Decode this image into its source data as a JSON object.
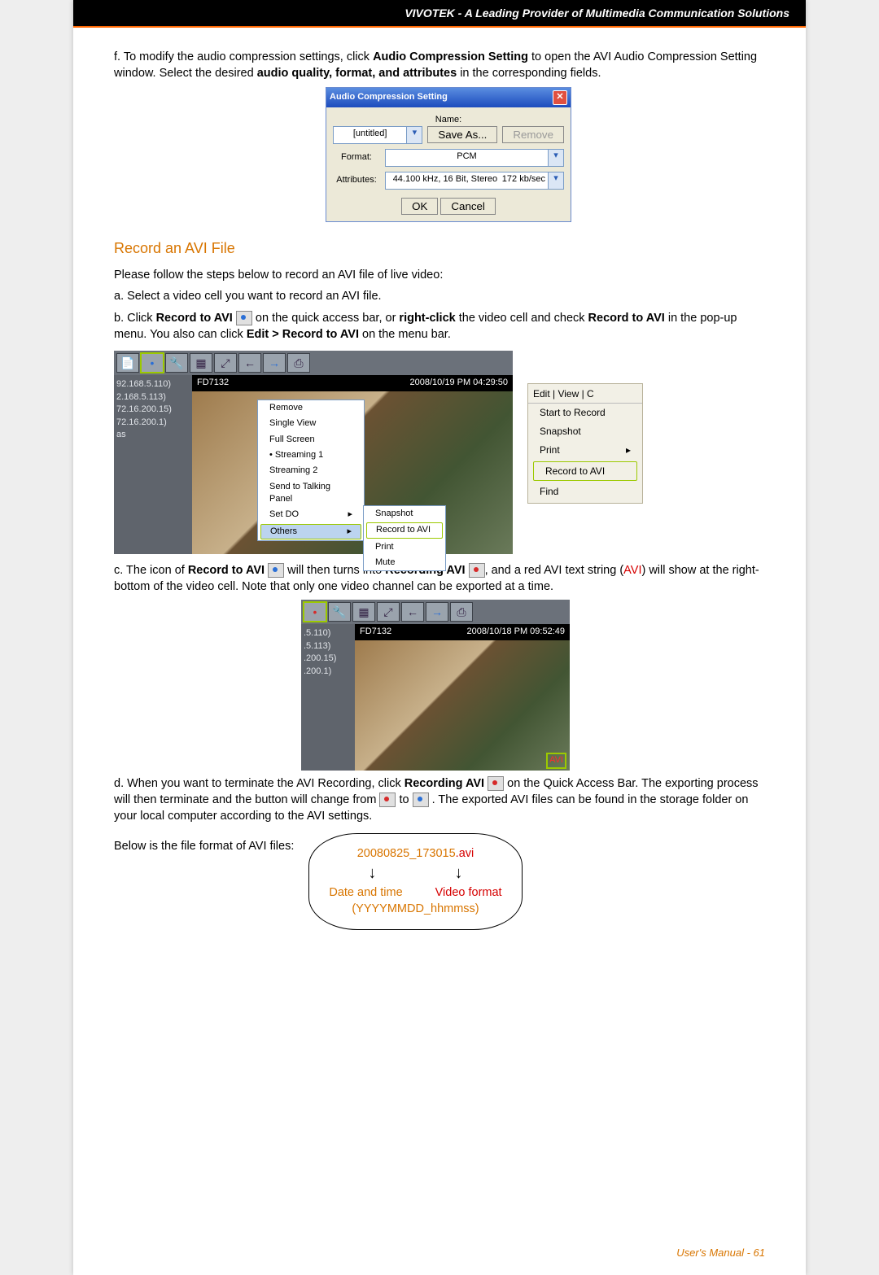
{
  "header": {
    "title": "VIVOTEK - A Leading Provider of Multimedia Communication Solutions"
  },
  "step_f": {
    "prefix": "f. To modify the audio compression settings, click ",
    "b1": "Audio Compression Setting",
    "mid": " to open the AVI Audio Compression Setting window. Select the desired ",
    "b2": "audio quality, format, and attributes",
    "suffix": " in the corresponding fields."
  },
  "dlg": {
    "title": "Audio Compression Setting",
    "name_label": "Name:",
    "name_value": "[untitled]",
    "save_as": "Save As...",
    "remove": "Remove",
    "format_label": "Format:",
    "format_value": "PCM",
    "attr_label": "Attributes:",
    "attr_value": "44.100 kHz, 16 Bit, Stereo",
    "attr_rate": "172 kb/sec",
    "ok": "OK",
    "cancel": "Cancel"
  },
  "section_title": "Record an AVI File",
  "intro": "Please follow the steps below to record an AVI file of live video:",
  "step_a": "a. Select a video cell you want to record an AVI file.",
  "step_b": {
    "p1": "b. Click ",
    "b1": "Record to AVI",
    "p2": " on the quick access bar, or ",
    "b2": "right-click",
    "p3": " the video cell and check ",
    "b3": "Record to AVI",
    "p4": " in the pop-up menu. You also can click ",
    "b4": "Edit > Record to AVI",
    "p5": " on the menu bar."
  },
  "toolbar_icons": [
    "📄",
    "•",
    "🔧",
    "▦",
    "⤢",
    "←",
    "→",
    "⎙"
  ],
  "video1": {
    "cam": "FD7132",
    "ts": "2008/10/19 PM 04:29:50",
    "ips": [
      "92.168.5.110)",
      "2.168.5.113)",
      "72.16.200.15)",
      "72.16.200.1)",
      "as"
    ],
    "ctx": {
      "items": [
        "Remove",
        "Single View",
        "Full Screen",
        "Streaming 1",
        "Streaming 2",
        "Send to Talking Panel",
        "Set DO",
        "Others"
      ],
      "bullet_index": 3,
      "hl_index": 7
    },
    "subctx": {
      "items": [
        "Snapshot",
        "Record to AVI",
        "Print",
        "Mute"
      ],
      "hl_index": 1
    }
  },
  "menu_panel": {
    "tabs": "Edit   |   View   |   C",
    "items": [
      "Start to Record",
      "Snapshot",
      "Print",
      "Record to AVI",
      "Find"
    ],
    "arrow_index": 2,
    "hl_index": 3
  },
  "step_c": {
    "p1": "c. The icon of ",
    "b1": "Record to AVI",
    "p2": " will then turns into ",
    "b2": "Recording AVI",
    "p3": ", and a red AVI text string (",
    "avi": "AVI",
    "p4": ") will show at the right-bottom of the video cell. Note that only one video channel can be exported at a time."
  },
  "video2": {
    "cam": "FD7132",
    "ts": "2008/10/18 PM 09:52:49",
    "ips": [
      ".5.110)",
      "",
      ".5.113)",
      ".200.15)",
      ".200.1)"
    ],
    "avibadge": "AVI"
  },
  "step_d": {
    "p1": "d. When you want to terminate the AVI Recording, click ",
    "b1": "Recording AVI",
    "p2": " on the Quick Access Bar. The exporting process will then terminate and the button will change from ",
    "p3": " to ",
    "p4": ". The exported AVI files can be found in the storage folder on your local computer according to the AVI settings."
  },
  "below": "Below is the file format of AVI files:",
  "fileformat": {
    "filename": "20080825_173015",
    "ext": ".avi",
    "l1": "Date and time",
    "l2": "Video format",
    "l3": "(YYYYMMDD_hhmmss)"
  },
  "footer": "User's Manual - 61"
}
